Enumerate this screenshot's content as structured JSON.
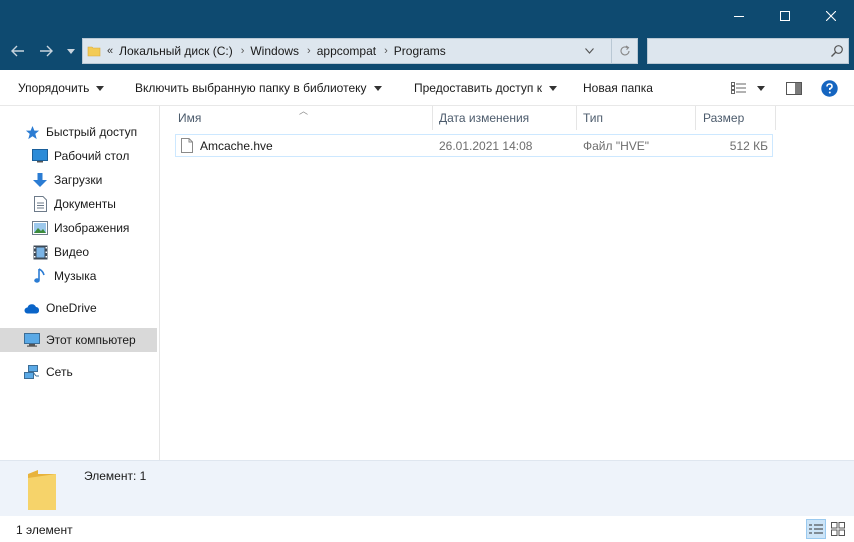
{
  "window": {
    "minimize_icon": "minimize-icon",
    "maximize_icon": "maximize-icon",
    "close_icon": "close-icon"
  },
  "address": {
    "more": "«",
    "crumbs": [
      "Локальный диск (C:)",
      "Windows",
      "appcompat",
      "Programs"
    ],
    "separator": "›"
  },
  "search": {
    "placeholder": ""
  },
  "toolbar": {
    "organize": "Упорядочить",
    "include_library": "Включить выбранную папку в библиотеку",
    "share": "Предоставить доступ к",
    "new_folder": "Новая папка"
  },
  "nav": {
    "quick_access": "Быстрый доступ",
    "desktop": "Рабочий стол",
    "downloads": "Загрузки",
    "documents": "Документы",
    "pictures": "Изображения",
    "videos": "Видео",
    "music": "Музыка",
    "onedrive": "OneDrive",
    "this_pc": "Этот компьютер",
    "network": "Сеть"
  },
  "columns": {
    "name": "Имя",
    "date": "Дата изменения",
    "type": "Тип",
    "size": "Размер"
  },
  "files": [
    {
      "name": "Amcache.hve",
      "date": "26.01.2021 14:08",
      "type": "Файл \"HVE\"",
      "size": "512 КБ"
    }
  ],
  "details": {
    "label": "Элемент: 1"
  },
  "status": {
    "count": "1 элемент"
  },
  "colors": {
    "titlebar": "#0e4a70",
    "selection": "#cde8ff",
    "details_bg": "#eef3fa"
  }
}
